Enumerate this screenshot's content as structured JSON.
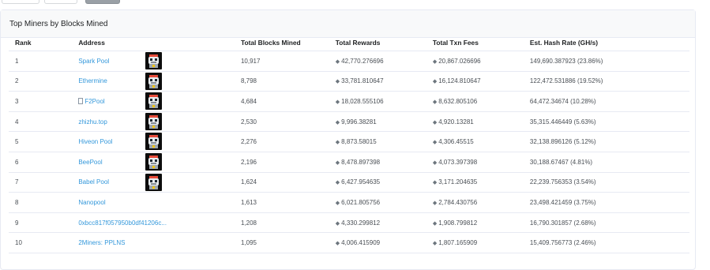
{
  "card": {
    "title": "Top Miners by Blocks Mined"
  },
  "columns": {
    "rank": "Rank",
    "address": "Address",
    "blocks": "Total Blocks Mined",
    "rewards": "Total Rewards",
    "fees": "Total Txn Fees",
    "hashrate": "Est. Hash Rate (GH/s)"
  },
  "icons": {
    "currency": "ethereum-icon",
    "contract": "file-icon",
    "avatar": "robot-avatar-icon"
  },
  "colors": {
    "link": "#3498db",
    "header_bg": "#f8f9fa",
    "border": "#e7eaf3"
  },
  "rows": [
    {
      "rank": "1",
      "address": "Spark Pool",
      "blocks": "10,917",
      "rewards": "42,770.276696",
      "fees": "20,867.026696",
      "hashrate": "149,690.387923 (23.86%)",
      "avatar": true,
      "contract": false
    },
    {
      "rank": "2",
      "address": "Ethermine",
      "blocks": "8,798",
      "rewards": "33,781.810647",
      "fees": "16,124.810647",
      "hashrate": "122,472.531886 (19.52%)",
      "avatar": true,
      "contract": false
    },
    {
      "rank": "3",
      "address": "F2Pool",
      "blocks": "4,684",
      "rewards": "18,028.555106",
      "fees": "8,632.805106",
      "hashrate": "64,472.34674 (10.28%)",
      "avatar": true,
      "contract": true
    },
    {
      "rank": "4",
      "address": "zhizhu.top",
      "blocks": "2,530",
      "rewards": "9,996.38281",
      "fees": "4,920.13281",
      "hashrate": "35,315.446449 (5.63%)",
      "avatar": true,
      "contract": false
    },
    {
      "rank": "5",
      "address": "Hiveon Pool",
      "blocks": "2,276",
      "rewards": "8,873.58015",
      "fees": "4,306.45515",
      "hashrate": "32,138.896126 (5.12%)",
      "avatar": true,
      "contract": false
    },
    {
      "rank": "6",
      "address": "BeePool",
      "blocks": "2,196",
      "rewards": "8,478.897398",
      "fees": "4,073.397398",
      "hashrate": "30,188.67467 (4.81%)",
      "avatar": true,
      "contract": false
    },
    {
      "rank": "7",
      "address": "Babel Pool",
      "blocks": "1,624",
      "rewards": "6,427.954635",
      "fees": "3,171.204635",
      "hashrate": "22,239.756353 (3.54%)",
      "avatar": true,
      "contract": false
    },
    {
      "rank": "8",
      "address": "Nanopool",
      "blocks": "1,613",
      "rewards": "6,021.805756",
      "fees": "2,784.430756",
      "hashrate": "23,498.421459 (3.75%)",
      "avatar": false,
      "contract": false
    },
    {
      "rank": "9",
      "address": "0xbcc817f057950b0df41206c...",
      "blocks": "1,208",
      "rewards": "4,330.299812",
      "fees": "1,908.799812",
      "hashrate": "16,790.301857 (2.68%)",
      "avatar": false,
      "contract": false
    },
    {
      "rank": "10",
      "address": "2Miners: PPLNS",
      "blocks": "1,095",
      "rewards": "4,006.415909",
      "fees": "1,807.165909",
      "hashrate": "15,409.756773 (2.46%)",
      "avatar": false,
      "contract": false
    }
  ]
}
